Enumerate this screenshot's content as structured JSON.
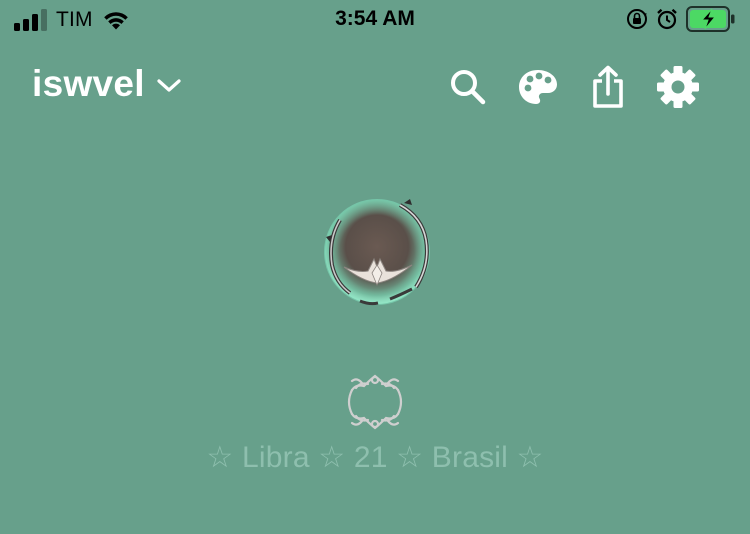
{
  "status_bar": {
    "carrier": "TIM",
    "time": "3:54 AM",
    "signal_bars_filled": 3,
    "signal_bars_total": 4,
    "battery_charging": true,
    "battery_color": "#4cd964"
  },
  "header": {
    "account_name": "iswvel",
    "icons": [
      "search-icon",
      "palette-icon",
      "share-icon",
      "gear-icon"
    ]
  },
  "profile": {
    "bio": "☆ Libra ☆ 21 ☆ Brasil ☆"
  },
  "colors": {
    "background": "#67a08b",
    "bio_text": "#8ebfae",
    "ornament": "#cfcfcf"
  }
}
